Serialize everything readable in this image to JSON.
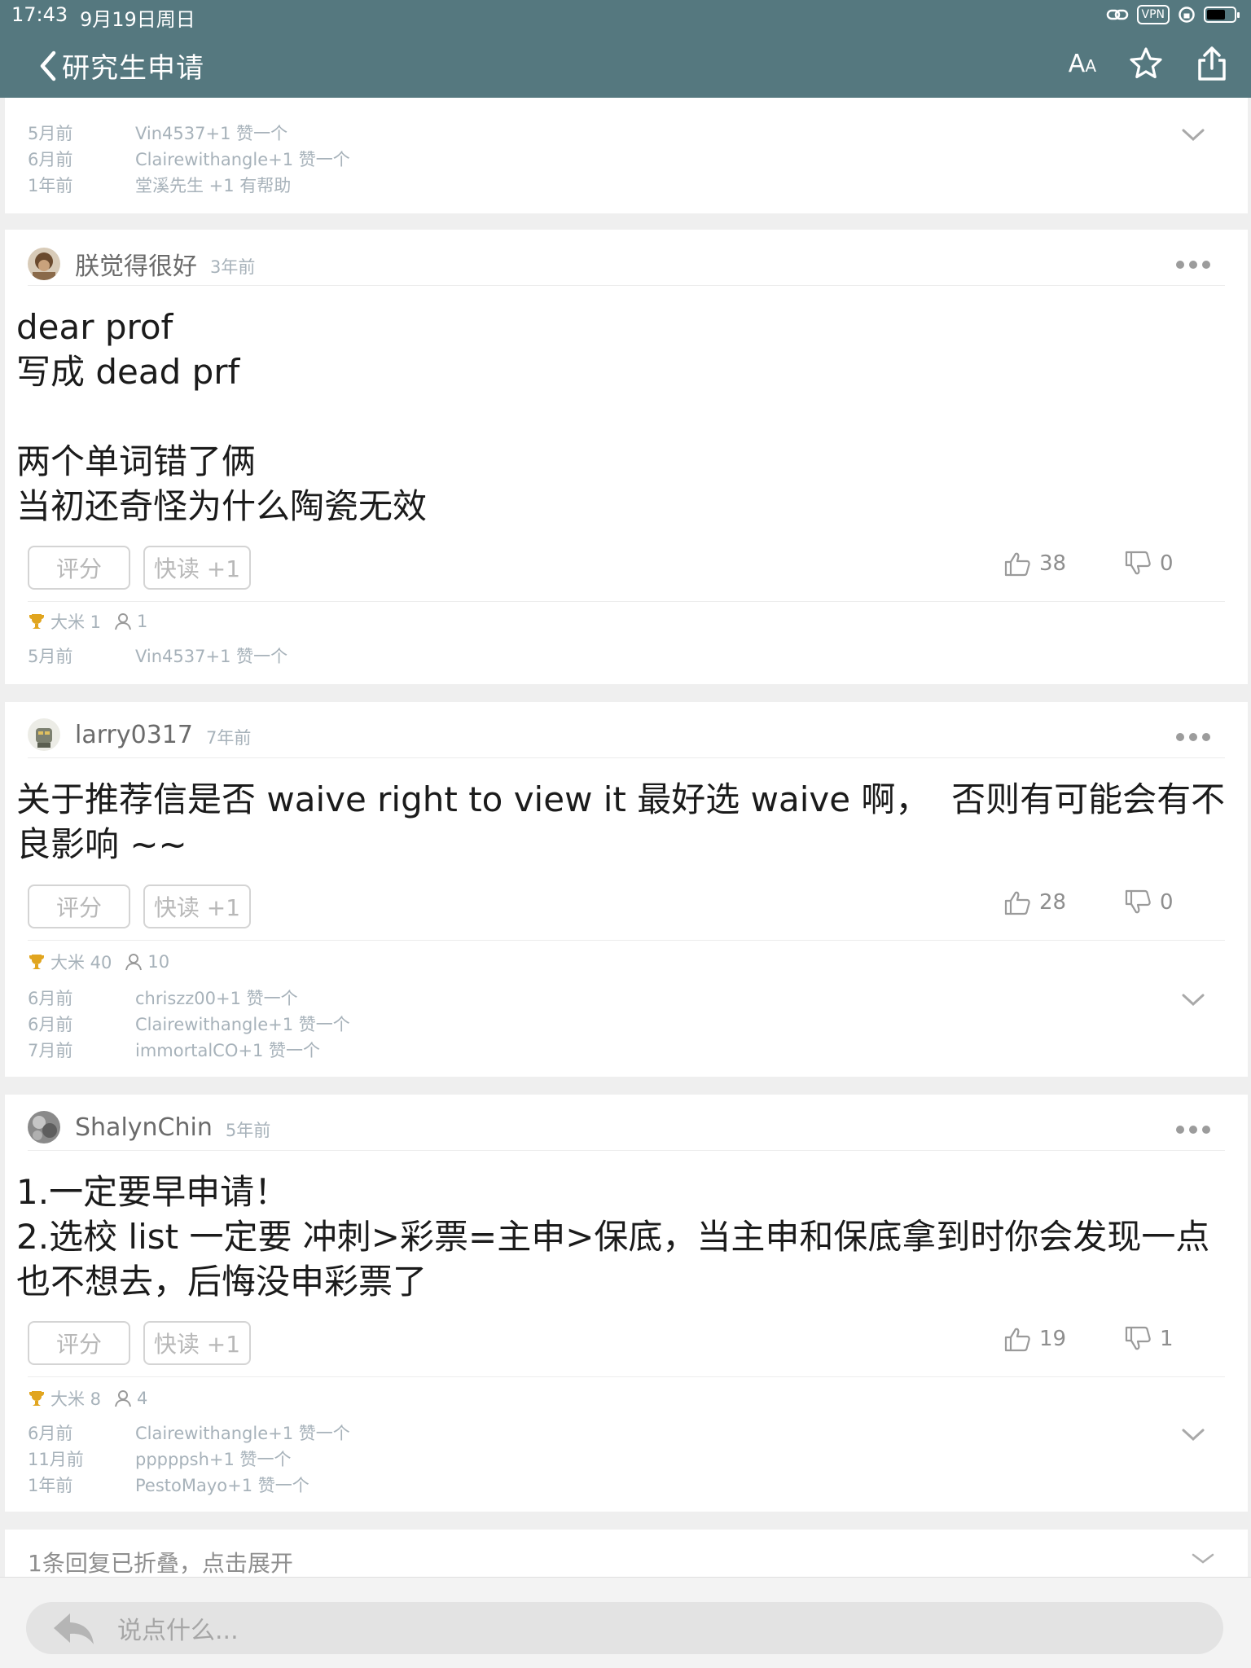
{
  "status_bar": {
    "time": "17:43",
    "date": "9月19日周日",
    "vpn": "VPN"
  },
  "nav": {
    "title": "研究生申请",
    "font_label": "A",
    "font_label_small": "A"
  },
  "top_partial": {
    "likes": [
      {
        "time": "5月前",
        "text": "Vin4537+1 赞一个"
      },
      {
        "time": "6月前",
        "text": "Clairewithangle+1 赞一个"
      },
      {
        "time": "1年前",
        "text": "堂溪先生 +1 有帮助"
      }
    ]
  },
  "labels": {
    "rate": "评分",
    "quick_read": "快读 +1"
  },
  "posts": [
    {
      "username": "朕觉得很好",
      "time": "3年前",
      "content": "dear prof\n写成 dead prf\n\n两个单词错了俩\n当初还奇怪为什么陶瓷无效",
      "likes": "38",
      "dislikes": "0",
      "rice": "大米 1",
      "people": "1",
      "activity": [
        {
          "time": "5月前",
          "text": "Vin4537+1 赞一个"
        }
      ]
    },
    {
      "username": "larry0317",
      "time": "7年前",
      "content": "关于推荐信是否 waive right to view it 最好选 waive 啊，  否则有可能会有不良影响 ~~",
      "likes": "28",
      "dislikes": "0",
      "rice": "大米 40",
      "people": "10",
      "activity": [
        {
          "time": "6月前",
          "text": "chriszz00+1 赞一个"
        },
        {
          "time": "6月前",
          "text": "Clairewithangle+1 赞一个"
        },
        {
          "time": "7月前",
          "text": "immortalCO+1 赞一个"
        }
      ]
    },
    {
      "username": "ShalynChin",
      "time": "5年前",
      "content": "1.一定要早申请！\n2.选校 list 一定要 冲刺>彩票=主申>保底，当主申和保底拿到时你会发现一点也不想去，后悔没申彩票了",
      "likes": "19",
      "dislikes": "1",
      "rice": "大米 8",
      "people": "4",
      "activity": [
        {
          "time": "6月前",
          "text": "Clairewithangle+1 赞一个"
        },
        {
          "time": "11月前",
          "text": "pppppsh+1 赞一个"
        },
        {
          "time": "1年前",
          "text": "PestoMayo+1 赞一个"
        }
      ]
    }
  ],
  "folded": {
    "text": "1条回复已折叠，点击展开"
  },
  "input": {
    "placeholder": "说点什么..."
  }
}
